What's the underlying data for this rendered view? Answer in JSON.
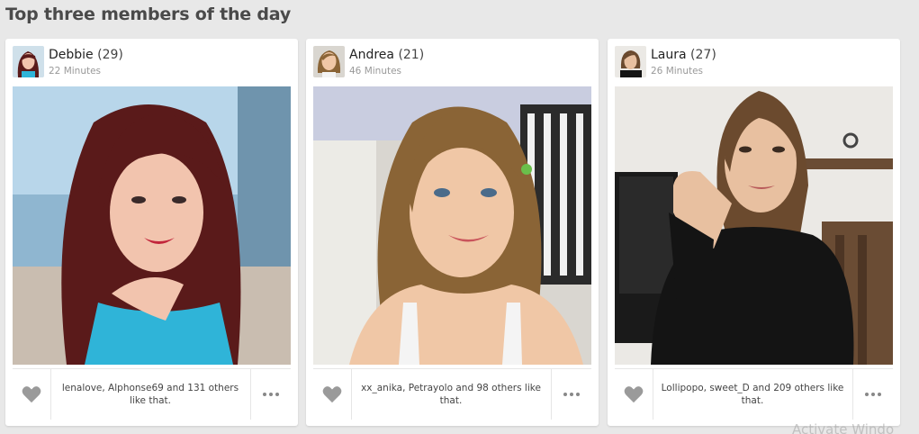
{
  "section": {
    "title": "Top three members of the day"
  },
  "members": [
    {
      "name": "Debbie",
      "age": "(29)",
      "time": "22 Minutes",
      "likes": "lenalove, Alphonse69 and 131 others like that.",
      "hair": "#5a1a1a",
      "skin": "#f2c4ae",
      "top": "#2fb4d8",
      "bg": "#8fb6d0"
    },
    {
      "name": "Andrea",
      "age": "(21)",
      "time": "46 Minutes",
      "likes": "xx_anika, Petrayolo and 98 others like that.",
      "hair": "#8a6436",
      "skin": "#f0c7a6",
      "top": "#f4f4f4",
      "bg": "#d9d6d0"
    },
    {
      "name": "Laura",
      "age": "(27)",
      "time": "26 Minutes",
      "likes": "Lollipopo, sweet_D and 209 others like that.",
      "hair": "#6b4a2e",
      "skin": "#e8c0a0",
      "top": "#141414",
      "bg": "#ebe9e5"
    }
  ],
  "icons": {
    "like": "heart-icon",
    "more": "more-dots-icon"
  },
  "watermark": "Activate Windo"
}
